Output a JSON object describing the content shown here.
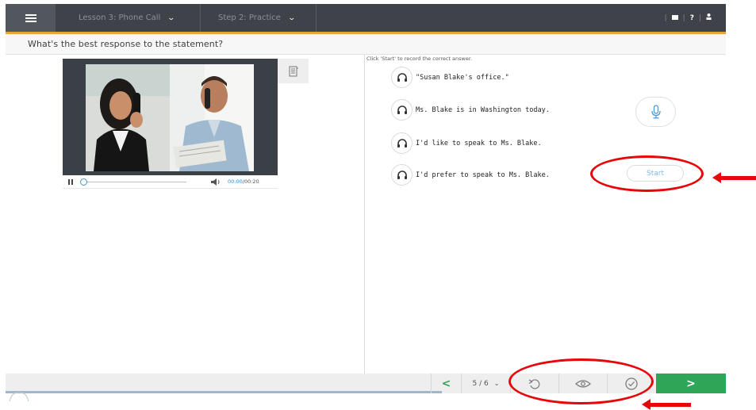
{
  "topbar": {
    "lesson_label": "Lesson 3: Phone Call",
    "step_label": "Step 2: Practice",
    "chevron": "⌄",
    "icons": [
      "messages-icon",
      "help-icon",
      "user-icon"
    ],
    "help_glyph": "?",
    "divider_glyph": "|"
  },
  "question": {
    "text": "What's the best response to the statement?"
  },
  "player": {
    "current_time": "00:00",
    "duration": "00:20",
    "time_separator": "/",
    "playing": true,
    "progress": 0
  },
  "answers": {
    "instruction": "Click 'Start' to record the correct answer.",
    "choices": [
      "\"Susan Blake's office.\"",
      "Ms. Blake is in Washington today.",
      "I'd like to speak to Ms. Blake.",
      "I'd prefer to speak to Ms. Blake."
    ],
    "start_label": "Start"
  },
  "footer": {
    "prev_glyph": "<",
    "pager": "5 / 6",
    "next_glyph": ">",
    "tools": [
      "reset-icon",
      "show-answer-icon",
      "check-answer-icon"
    ]
  },
  "colors": {
    "topbar": "#3f4349",
    "accent_line": "#e2a63a",
    "next_button": "#2fa657",
    "annotation": "#e8060b"
  }
}
